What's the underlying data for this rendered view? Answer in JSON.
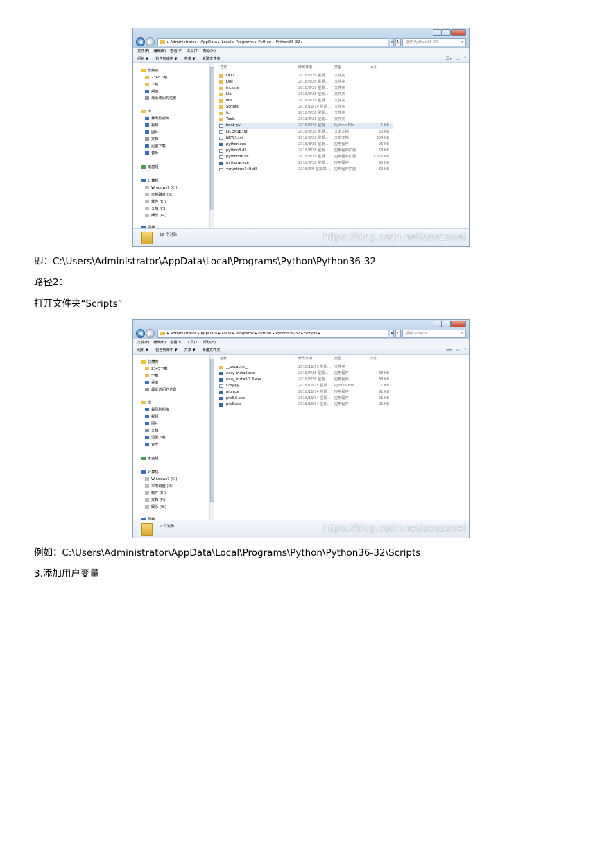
{
  "screenshot1": {
    "address_crumbs": [
      "Administrator",
      "AppData",
      "Local",
      "Programs",
      "Python",
      "Python36-32"
    ],
    "search_placeholder": "搜索 Python36-32",
    "menu": [
      "文件(F)",
      "编辑(E)",
      "查看(V)",
      "工具(T)",
      "帮助(H)"
    ],
    "toolbar": [
      "组织 ▼",
      "包含到库中 ▼",
      "共享 ▼",
      "新建文件夹"
    ],
    "columns": {
      "name": "名称",
      "date": "修改日期",
      "type": "类型",
      "size": "大小"
    },
    "files": [
      {
        "name": "DLLs",
        "date": "2018/6/28 星期...",
        "type": "文件夹",
        "size": "",
        "kind": "folder"
      },
      {
        "name": "Doc",
        "date": "2018/6/28 星期...",
        "type": "文件夹",
        "size": "",
        "kind": "folder"
      },
      {
        "name": "include",
        "date": "2018/6/28 星期...",
        "type": "文件夹",
        "size": "",
        "kind": "folder"
      },
      {
        "name": "Lib",
        "date": "2018/6/28 星期...",
        "type": "文件夹",
        "size": "",
        "kind": "folder"
      },
      {
        "name": "libs",
        "date": "2018/6/28 星期...",
        "type": "文件夹",
        "size": "",
        "kind": "folder"
      },
      {
        "name": "Scripts",
        "date": "2018/11/14 星期...",
        "type": "文件夹",
        "size": "",
        "kind": "folder"
      },
      {
        "name": "tcl",
        "date": "2018/6/28 星期...",
        "type": "文件夹",
        "size": "",
        "kind": "folder"
      },
      {
        "name": "Tools",
        "date": "2018/6/28 星期...",
        "type": "文件夹",
        "size": "",
        "kind": "folder"
      },
      {
        "name": "imok.py",
        "date": "2018/6/28 星期...",
        "type": "Python File",
        "size": "1 KB",
        "kind": "file"
      },
      {
        "name": "LICENSE.txt",
        "date": "2018/3/28 星期...",
        "type": "文本文档",
        "size": "30 KB",
        "kind": "file"
      },
      {
        "name": "NEWS.txt",
        "date": "2018/3/28 星期...",
        "type": "文本文档",
        "size": "384 KB",
        "kind": "file"
      },
      {
        "name": "python.exe",
        "date": "2018/3/28 星期...",
        "type": "应用程序",
        "size": "96 KB",
        "kind": "exe"
      },
      {
        "name": "python3.dll",
        "date": "2018/3/28 星期...",
        "type": "应用程序扩展",
        "size": "58 KB",
        "kind": "file"
      },
      {
        "name": "python36.dll",
        "date": "2018/3/28 星期...",
        "type": "应用程序扩展",
        "size": "3,226 KB",
        "kind": "file"
      },
      {
        "name": "pythonw.exe",
        "date": "2018/3/28 星期...",
        "type": "应用程序",
        "size": "95 KB",
        "kind": "exe"
      },
      {
        "name": "vcruntime140.dll",
        "date": "2016/6/9 星期四 ...",
        "type": "应用程序扩展",
        "size": "82 KB",
        "kind": "file"
      }
    ],
    "status_count": "16 个对象",
    "watermark": "https://blog.csdn.net/saozswei"
  },
  "screenshot2": {
    "address_crumbs": [
      "Administrator",
      "AppData",
      "Local",
      "Programs",
      "Python",
      "Python36-32",
      "Scripts"
    ],
    "search_placeholder": "搜索 Scripts",
    "menu": [
      "文件(F)",
      "编辑(E)",
      "查看(V)",
      "工具(T)",
      "帮助(H)"
    ],
    "toolbar": [
      "组织 ▼",
      "包含到库中 ▼",
      "共享 ▼",
      "新建文件夹"
    ],
    "columns": {
      "name": "名称",
      "date": "修改日期",
      "type": "类型",
      "size": "大小"
    },
    "files": [
      {
        "name": "__pycache__",
        "date": "2018/11/15 星期...",
        "type": "文件夹",
        "size": "",
        "kind": "folder"
      },
      {
        "name": "easy_install.exe",
        "date": "2018/6/28 星期...",
        "type": "应用程序",
        "size": "88 KB",
        "kind": "exe"
      },
      {
        "name": "easy_install-3.6.exe",
        "date": "2018/6/28 星期...",
        "type": "应用程序",
        "size": "88 KB",
        "kind": "exe"
      },
      {
        "name": "f2py.py",
        "date": "2018/11/15 星期...",
        "type": "Python File",
        "size": "1 KB",
        "kind": "file"
      },
      {
        "name": "pip.exe",
        "date": "2018/11/14 星期...",
        "type": "应用程序",
        "size": "91 KB",
        "kind": "exe"
      },
      {
        "name": "pip3.6.exe",
        "date": "2018/11/14 星期...",
        "type": "应用程序",
        "size": "91 KB",
        "kind": "exe"
      },
      {
        "name": "pip3.exe",
        "date": "2018/11/14 星期...",
        "type": "应用程序",
        "size": "91 KB",
        "kind": "exe"
      }
    ],
    "status_count": "7 个对象",
    "watermark": "https://blog.csdn.net/saozswei"
  },
  "nav_pane": {
    "favorites": "收藏夹",
    "fav_items": [
      "2345下载",
      "下载",
      "桌面",
      "最近访问的位置"
    ],
    "libraries": "库",
    "lib_items": [
      "暴风影视库",
      "视频",
      "图片",
      "文档",
      "迅雷下载",
      "音乐"
    ],
    "homegroup": "家庭组",
    "computer": "计算机",
    "drives": [
      "Windows7 (C:)",
      "本地磁盘 (D:)",
      "软件 (E:)",
      "文档 (F:)",
      "娱乐 (G:)"
    ],
    "network": "网络"
  },
  "text": {
    "line1": "即：C:\\Users\\Administrator\\AppData\\Local\\Programs\\Python\\Python36-32",
    "line2": "路径2：",
    "line3": "打开文件夹“Scripts”",
    "line4": "例如：C:\\Users\\Administrator\\AppData\\Local\\Programs\\Python\\Python36-32\\Scripts",
    "line5": "3.添加用户变量"
  }
}
